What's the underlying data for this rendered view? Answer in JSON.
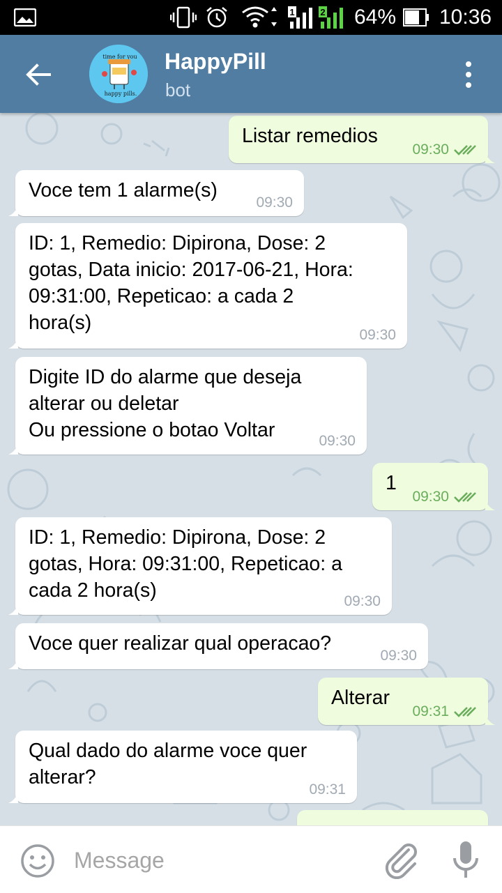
{
  "status_bar": {
    "battery": "64%",
    "time": "10:36",
    "sim1": "1",
    "sim2": "2"
  },
  "header": {
    "title": "HappyPill",
    "subtitle": "bot",
    "avatar_text_top": "time for you",
    "avatar_text_bottom": "happy pills."
  },
  "colors": {
    "header_bg": "#517da2",
    "chat_bg": "#d6dfe6",
    "incoming_bubble": "#ffffff",
    "outgoing_bubble": "#effdde",
    "outgoing_meta": "#6aad5c"
  },
  "messages": [
    {
      "dir": "out",
      "text": "Listar remedios",
      "time": "09:30",
      "read": true
    },
    {
      "dir": "in",
      "text": "Voce tem 1 alarme(s)",
      "time": "09:30"
    },
    {
      "dir": "in",
      "text": "ID: 1, Remedio: Dipirona, Dose: 2\ngotas, Data inicio: 2017-06-21, Hora:\n09:31:00, Repeticao: a cada 2\nhora(s)",
      "time": "09:30"
    },
    {
      "dir": "in",
      "text": "Digite ID do alarme que deseja\nalterar ou deletar\nOu pressione o botao Voltar",
      "time": "09:30"
    },
    {
      "dir": "out",
      "text": "1",
      "time": "09:30",
      "read": true
    },
    {
      "dir": "in",
      "text": "ID: 1, Remedio: Dipirona, Dose: 2\ngotas, Hora: 09:31:00, Repeticao: a\ncada 2 hora(s)",
      "time": "09:30"
    },
    {
      "dir": "in",
      "text": "Voce quer realizar qual operacao?",
      "time": "09:30"
    },
    {
      "dir": "out",
      "text": "Alterar",
      "time": "09:31",
      "read": true
    },
    {
      "dir": "in",
      "text": "Qual dado do alarme voce quer\nalterar?",
      "time": "09:31"
    },
    {
      "dir": "out",
      "text": "",
      "time": "",
      "read": true
    }
  ],
  "composer": {
    "placeholder": "Message"
  },
  "icons": {
    "back": "arrow-left-icon",
    "menu": "more-vertical-icon",
    "emoji": "smiley-icon",
    "attach": "paperclip-icon",
    "mic": "microphone-icon",
    "read": "double-check-icon"
  }
}
